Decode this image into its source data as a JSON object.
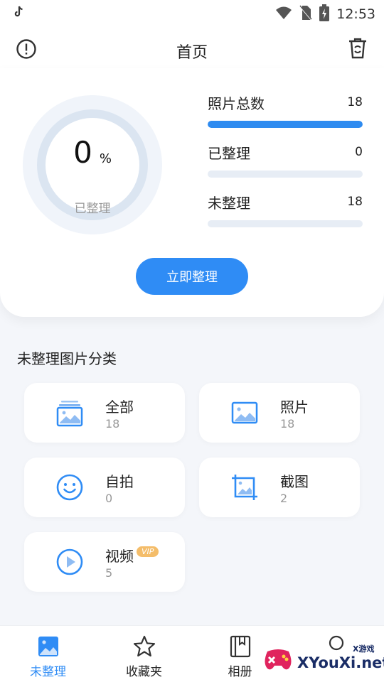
{
  "status_bar": {
    "time": "12:53"
  },
  "header": {
    "title": "首页"
  },
  "summary": {
    "percent": "0",
    "percent_unit": "%",
    "percent_label": "已整理",
    "stats": [
      {
        "name": "照片总数",
        "value": "18",
        "fill": 1.0
      },
      {
        "name": "已整理",
        "value": "0",
        "fill": 0.0
      },
      {
        "name": "未整理",
        "value": "18",
        "fill": 0.0
      }
    ],
    "action_label": "立即整理"
  },
  "categories": {
    "title": "未整理图片分类",
    "items": [
      {
        "name": "全部",
        "count": "18",
        "icon": "gallery-stack-icon"
      },
      {
        "name": "照片",
        "count": "18",
        "icon": "image-icon"
      },
      {
        "name": "自拍",
        "count": "0",
        "icon": "smiley-icon"
      },
      {
        "name": "截图",
        "count": "2",
        "icon": "crop-image-icon"
      },
      {
        "name": "视频",
        "count": "5",
        "icon": "play-icon",
        "badge": "VIP"
      }
    ]
  },
  "tabbar": {
    "tabs": [
      {
        "label": "未整理",
        "icon": "image-icon",
        "active": true
      },
      {
        "label": "收藏夹",
        "icon": "star-icon",
        "active": false
      },
      {
        "label": "相册",
        "icon": "album-icon",
        "active": false
      }
    ]
  },
  "watermark": {
    "brand": "XYouXi.net",
    "small": "X游戏"
  },
  "colors": {
    "accent": "#2f8cf5",
    "track": "#e7edf5",
    "vip": "#f4bd6a"
  }
}
